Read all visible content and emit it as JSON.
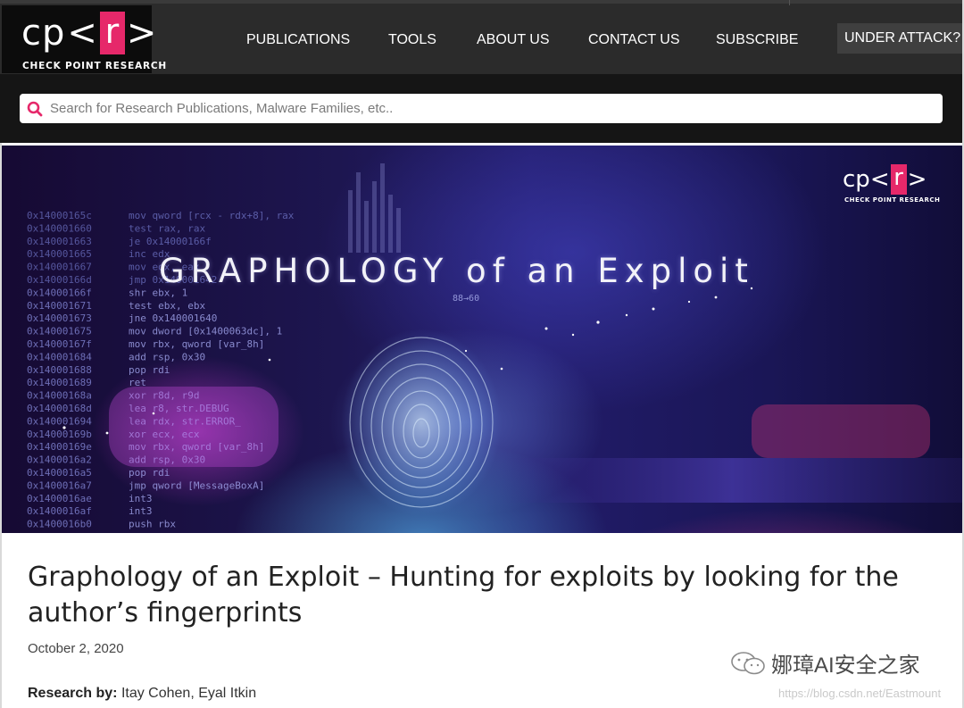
{
  "header": {
    "logo_text_cp": "cp",
    "logo_text_lt": "<",
    "logo_text_r": "r",
    "logo_text_gt": ">",
    "logo_subtitle": "CHECK POINT RESEARCH",
    "nav": [
      "PUBLICATIONS",
      "TOOLS",
      "ABOUT US",
      "CONTACT US",
      "SUBSCRIBE"
    ],
    "attack_button": "UNDER ATTACK?"
  },
  "search": {
    "placeholder": "Search for Research Publications, Malware Families, etc.."
  },
  "hero": {
    "title": "GRAPHOLOGY of an Exploit",
    "logo_text_cp": "cp",
    "logo_text_lt": "<",
    "logo_text_r": "r",
    "logo_text_gt": ">",
    "logo_subtitle": "CHECK POINT RESEARCH",
    "code_addresses": [
      "0x14000165c",
      "0x140001660",
      "0x140001663",
      "0x140001665",
      "0x140001667",
      "0x14000166d",
      "0x14000166f",
      "0x140001671",
      "0x140001673",
      "0x140001675",
      "0x14000167f",
      "0x140001684",
      "0x140001688",
      "0x140001689",
      "0x14000168a",
      "0x14000168d",
      "0x140001694",
      "0x14000169b",
      "0x14000169e",
      "0x1400016a2",
      "0x1400016a5",
      "0x1400016a7",
      "0x1400016ae",
      "0x1400016af",
      "0x1400016b0"
    ],
    "code_lines": [
      "mov qword [rcx - rdx+8], rax",
      "test rax, rax",
      "je 0x14000166f",
      "inc edx",
      "mov edx, eax",
      "jmp 0x140001642",
      "shr ebx, 1",
      "test ebx, ebx",
      "jne 0x140001640",
      "mov dword [0x1400063dc], 1",
      "mov rbx, qword [var_8h]",
      "add rsp, 0x30",
      "pop rdi",
      "ret",
      "xor r8d, r9d",
      "lea r8, str.DEBUG",
      "lea rdx, str.ERROR_",
      "xor ecx, ecx",
      "mov rbx, qword [var_8h]",
      "add rsp, 0x30",
      "pop rdi",
      "jmp qword [MessageBoxA]",
      "int3",
      "int3",
      "push rbx"
    ]
  },
  "article": {
    "title": "Graphology of an Exploit – Hunting for exploits by looking for the author’s fingerprints",
    "date": "October 2, 2020",
    "byline_label": "Research by:",
    "byline_authors": " Itay Cohen, Eyal Itkin"
  },
  "watermark": {
    "text": "娜璋AI安全之家",
    "url": "https://blog.csdn.net/Eastmount"
  },
  "colors": {
    "brand_pink": "#e6286a",
    "header_bg": "#2b2b2b",
    "search_band_bg": "#151515"
  }
}
